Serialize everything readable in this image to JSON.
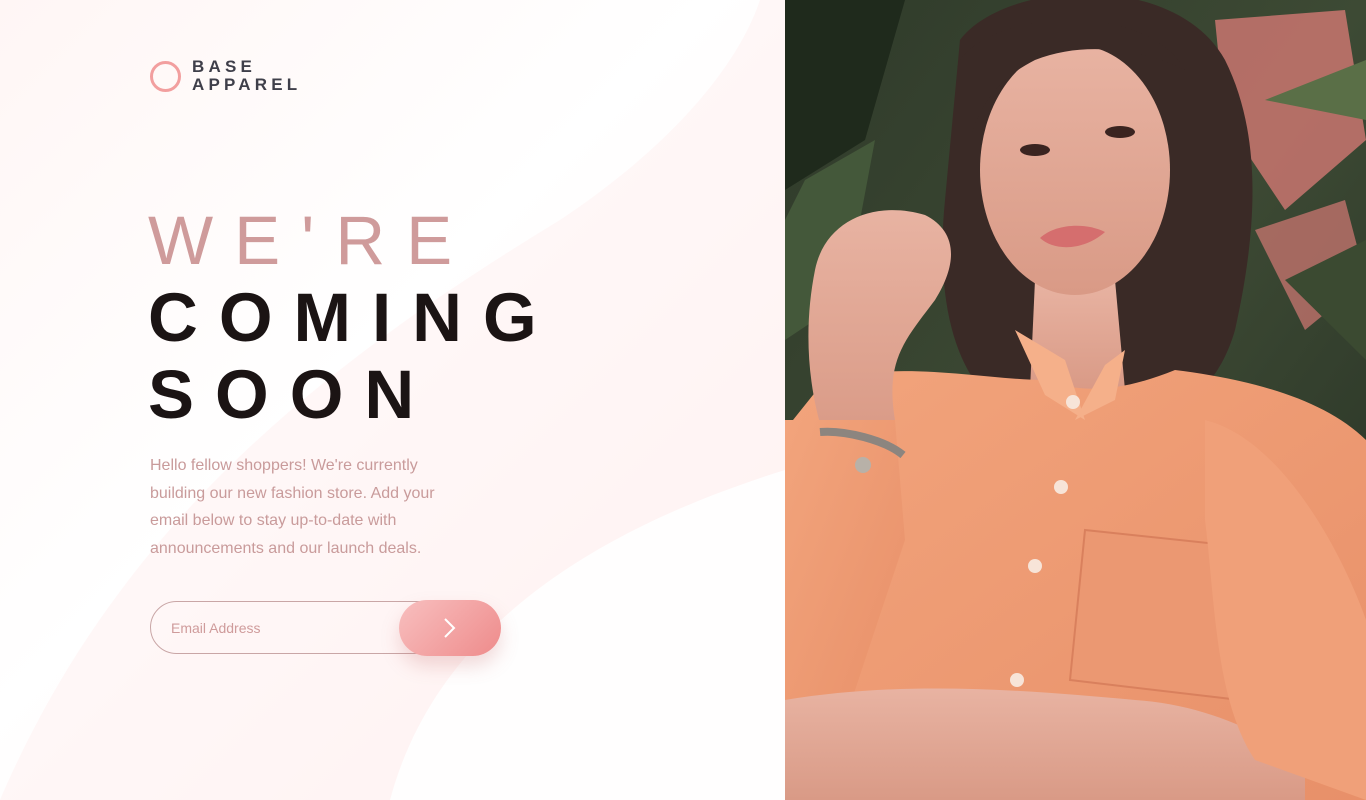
{
  "brand": {
    "line1": "BASE",
    "line2": "APPAREL",
    "accent_color": "#f29f9f"
  },
  "hero": {
    "headline_light": "WE'RE",
    "headline_bold_1": "COMING",
    "headline_bold_2": "SOON",
    "description": "Hello fellow shoppers! We're currently building our new fashion store. Add your email below to stay up-to-date with announcements and our launch deals."
  },
  "signup": {
    "email_placeholder": "Email Address",
    "email_value": "",
    "submit_icon": "chevron-right-icon"
  },
  "colors": {
    "primary_soft": "#cf9b9b",
    "primary_dark": "#1b1414",
    "button_gradient_start": "#f8bfbf",
    "button_gradient_end": "#ee8b8b"
  },
  "hero_image": {
    "subject": "hero-photo"
  }
}
